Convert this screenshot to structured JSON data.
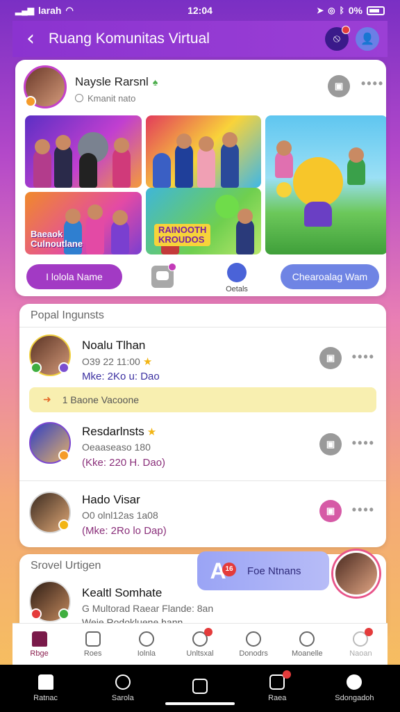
{
  "status": {
    "carrier": "larah",
    "time": "12:04",
    "battery": "0%"
  },
  "header": {
    "title": "Ruang Komunitas Virtual",
    "back_icon": "chevron-left-icon",
    "left_icon": "no-sign-icon",
    "right_icon": "user-icon"
  },
  "post": {
    "author": "Naysle Rarsnl",
    "subtitle": "Kmanit nato",
    "tiles": [
      {
        "caption": ""
      },
      {
        "caption": ""
      },
      {
        "caption": "Baeaok\nCulnoutlane"
      },
      {
        "caption": "RAINOOTH\nKROUDOS"
      },
      {
        "caption": ""
      }
    ],
    "actions": {
      "primary": "I lolola Name",
      "details": "Oetals",
      "secondary": "Chearoalag Wam"
    }
  },
  "section": {
    "title": "Popal Ingunsts",
    "banner": "1 Baone Vacoone",
    "rows": [
      {
        "name": "Noalu Tlhan",
        "meta": "O39 22 11:00",
        "loc": "Mke: 2Ko u: Dao"
      },
      {
        "name": "Resdarlnsts",
        "meta": "Oeaaseaso 180",
        "loc": "(Kke: 220 H. Dao)"
      },
      {
        "name": "Hado Visar",
        "meta": "O0 olnl12as 1a08",
        "loc": "(Mke: 2Ro lo Dap)"
      }
    ]
  },
  "bottom_section": {
    "title": "Srovel Urtigen",
    "row": {
      "name": "Kealtl Somhate",
      "meta": "G Multorad Raear Flande: 8an",
      "loc": "Weie Rodokluene hann"
    }
  },
  "floating": {
    "letter": "A",
    "badge": "16",
    "label": "Foe Ntnans"
  },
  "tabs_top": [
    {
      "label": "Rbge",
      "icon": "home-icon"
    },
    {
      "label": "Roes",
      "icon": "newspaper-icon"
    },
    {
      "label": "Iolnla",
      "icon": "check-icon"
    },
    {
      "label": "Unltsxal",
      "icon": "chat-icon"
    },
    {
      "label": "Donodrs",
      "icon": "comment-icon"
    },
    {
      "label": "Moanelle",
      "icon": "group-icon"
    },
    {
      "label": "Naoan",
      "icon": "user-icon"
    }
  ],
  "tabs_bottom": [
    {
      "label": "Ratnac",
      "icon": "home-icon"
    },
    {
      "label": "Sarola",
      "icon": "search-icon"
    },
    {
      "label": "",
      "icon": "grid-icon"
    },
    {
      "label": "Raea",
      "icon": "calendar-icon"
    },
    {
      "label": "Sdongadoh",
      "icon": "user-icon"
    }
  ],
  "colors": {
    "brand": "#8b33d0",
    "accent_blue": "#6f84e4",
    "accent_purple": "#a23ac4",
    "banner": "#f8efb0"
  }
}
